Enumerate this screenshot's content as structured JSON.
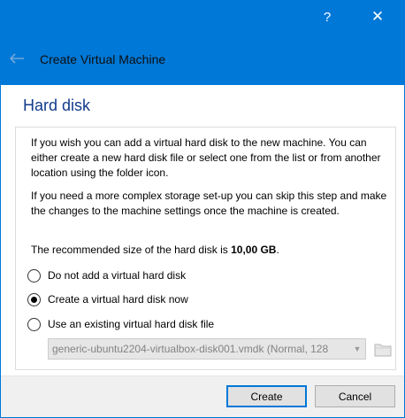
{
  "titlebar": {
    "help_glyph": "?",
    "close_glyph": "✕"
  },
  "header": {
    "title": "Create Virtual Machine",
    "back_icon": "arrow-left-icon"
  },
  "page": {
    "title": "Hard disk",
    "paragraph1": "If you wish you can add a virtual hard disk to the new machine. You can either create a new hard disk file or select one from the list or from another location using the folder icon.",
    "paragraph2": "If you need a more complex storage set-up you can skip this step and make the changes to the machine settings once the machine is created.",
    "recommended_prefix": "The recommended size of the hard disk is ",
    "recommended_size": "10,00 GB",
    "recommended_suffix": "."
  },
  "options": [
    {
      "label": "Do not add a virtual hard disk",
      "checked": false
    },
    {
      "label": "Create a virtual hard disk now",
      "checked": true
    },
    {
      "label": "Use an existing virtual hard disk file",
      "checked": false
    }
  ],
  "existing_disk": {
    "selected": "generic-ubuntu2204-virtualbox-disk001.vmdk (Normal, 128",
    "folder_icon": "folder-icon"
  },
  "footer": {
    "create_label": "Create",
    "cancel_label": "Cancel"
  },
  "colors": {
    "accent": "#0078d7",
    "title": "#123b8c"
  }
}
